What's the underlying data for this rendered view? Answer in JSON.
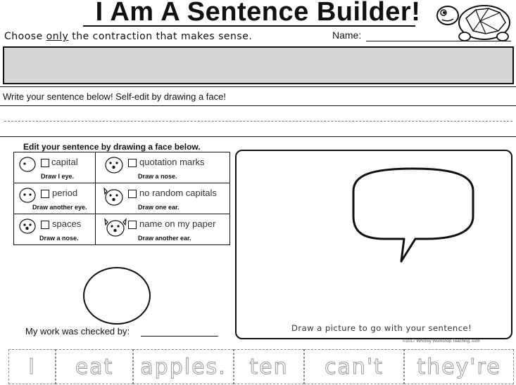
{
  "header": {
    "title": "I Am A Sentence Builder!",
    "instruction_pre": "Choose ",
    "instruction_emph": "only",
    "instruction_post": " the contraction that makes sense.",
    "name_label": "Name:"
  },
  "write_label": "Write your sentence below! Self-edit by drawing a face!",
  "edit": {
    "title": "Edit your sentence by drawing a face below.",
    "items": [
      {
        "label": "capital",
        "sub": "Draw I eye."
      },
      {
        "label": "quotation marks",
        "sub": "Draw a nose."
      },
      {
        "label": "period",
        "sub": "Draw another eye."
      },
      {
        "label": "no random capitals",
        "sub": "Draw one ear."
      },
      {
        "label": "spaces",
        "sub": "Draw a nose."
      },
      {
        "label": "name on my paper",
        "sub": "Draw another ear."
      }
    ]
  },
  "checked_label": "My work was checked by:",
  "picture_caption": "Draw a picture to go with your sentence!",
  "copyright": "©2017 Whimsy Workshop Teaching .com",
  "word_cards": [
    "I",
    "eat",
    "apples.",
    "ten",
    "can't",
    "they're"
  ]
}
